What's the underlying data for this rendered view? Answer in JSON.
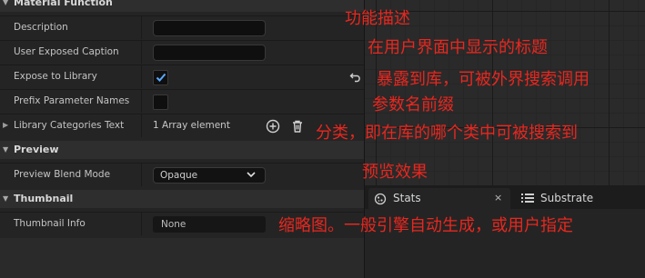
{
  "sections": {
    "material_function": "Material Function",
    "preview": "Preview",
    "thumbnail": "Thumbnail"
  },
  "properties": {
    "description": {
      "label": "Description",
      "value": ""
    },
    "user_exposed_caption": {
      "label": "User Exposed Caption",
      "value": ""
    },
    "expose_to_library": {
      "label": "Expose to Library",
      "checked": true
    },
    "prefix_parameter_names": {
      "label": "Prefix Parameter Names",
      "checked": false
    },
    "library_categories_text": {
      "label": "Library Categories Text",
      "value": "1 Array element"
    },
    "preview_blend_mode": {
      "label": "Preview Blend Mode",
      "value": "Opaque"
    },
    "thumbnail_info": {
      "label": "Thumbnail Info",
      "value": "None"
    }
  },
  "tabs": {
    "stats": {
      "label": "Stats",
      "close": "×"
    },
    "substrate": {
      "label": "Substrate"
    }
  },
  "icons": {
    "checkmark": "check-icon",
    "reset": "reset-arrow-icon",
    "add": "plus-circle-icon",
    "delete": "trash-icon",
    "chevron": "chevron-down-icon",
    "stats_tab": "stats-icon",
    "substrate_tab": "substrate-icon"
  },
  "colors": {
    "accent_check": "#5aa9ff",
    "annotation": "#e8271f",
    "panel_bg": "#242424"
  },
  "annotations": {
    "description": "功能描述",
    "caption": "在用户界面中显示的标题",
    "expose": "暴露到库，可被外界搜索调用",
    "prefix": "参数名前缀",
    "categories": "分类，即在库的哪个类中可被搜索到",
    "preview": "预览效果",
    "thumbnail": "缩略图。一般引擎自动生成，或用户指定"
  }
}
